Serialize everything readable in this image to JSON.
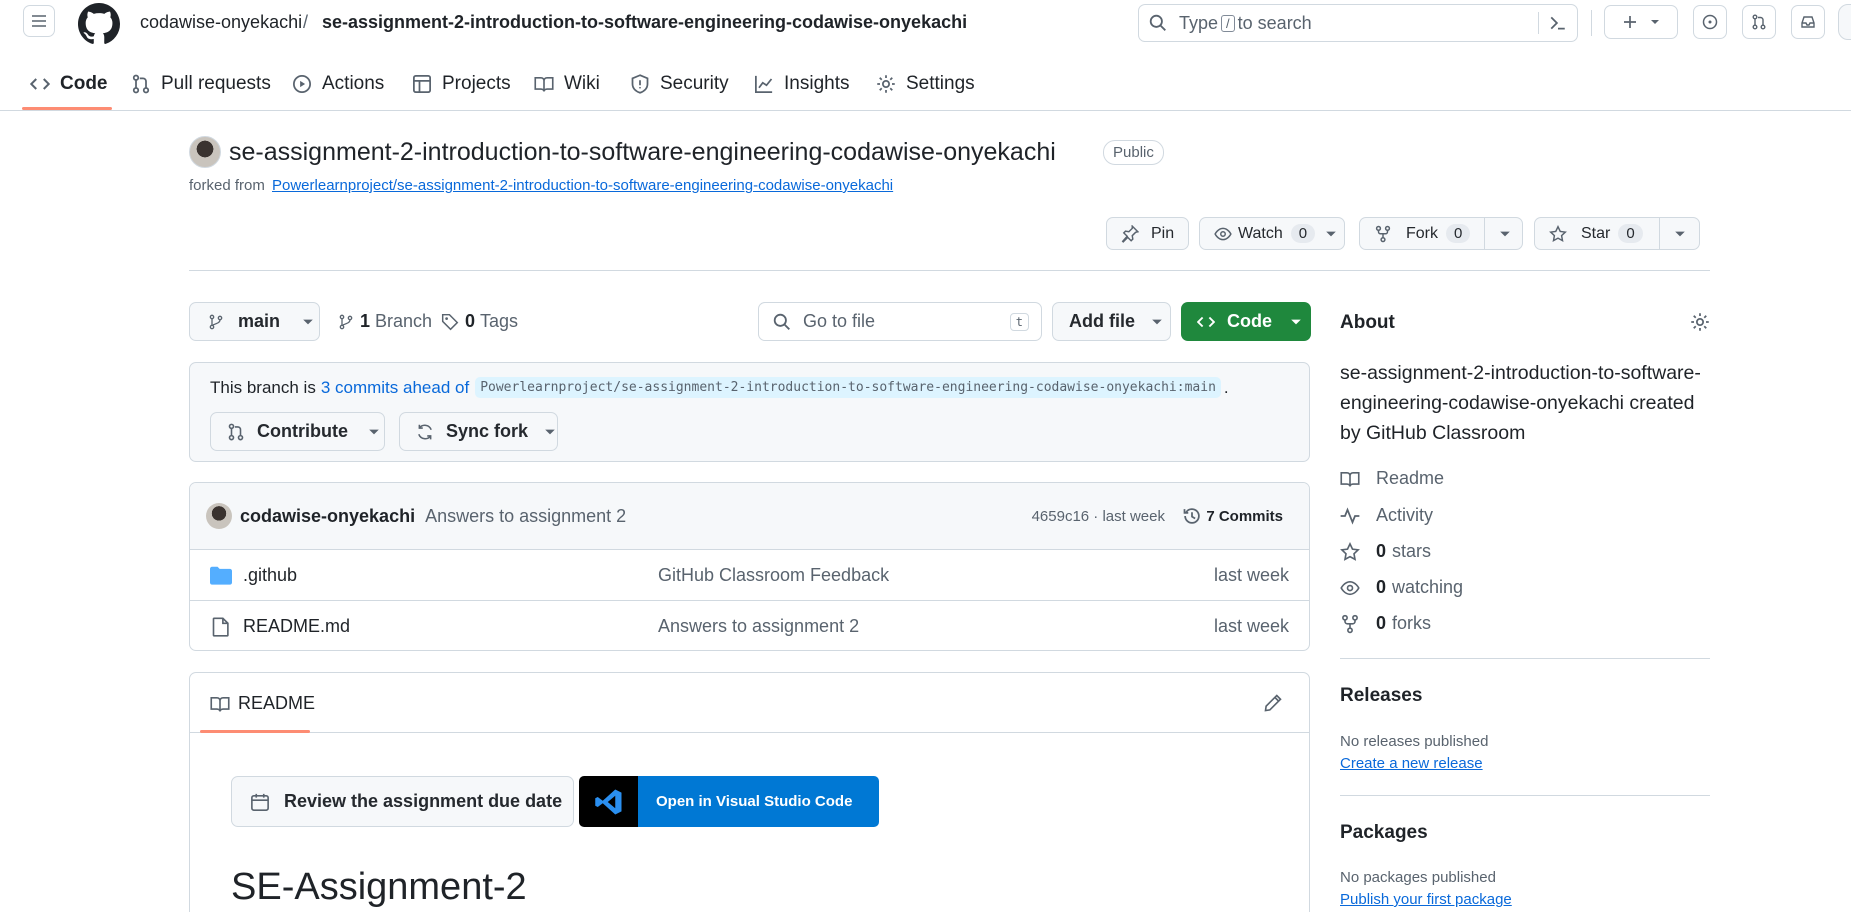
{
  "header": {
    "owner": "codawise-onyekachi",
    "separator": "/",
    "repo": "se-assignment-2-introduction-to-software-engineering-codawise-onyekachi",
    "search_pre": "Type",
    "search_key": "/",
    "search_post": "to search"
  },
  "nav": {
    "tabs": [
      {
        "label": "Code"
      },
      {
        "label": "Pull requests"
      },
      {
        "label": "Actions"
      },
      {
        "label": "Projects"
      },
      {
        "label": "Wiki"
      },
      {
        "label": "Security"
      },
      {
        "label": "Insights"
      },
      {
        "label": "Settings"
      }
    ]
  },
  "repo": {
    "name": "se-assignment-2-introduction-to-software-engineering-codawise-onyekachi",
    "visibility": "Public",
    "forked_prefix": "forked from",
    "forked_from": "Powerlearnproject/se-assignment-2-introduction-to-software-engineering-codawise-onyekachi",
    "pin": "Pin",
    "watch": "Watch",
    "watch_count": "0",
    "fork": "Fork",
    "fork_count": "0",
    "star": "Star",
    "star_count": "0"
  },
  "toolbar": {
    "branch": "main",
    "branches_count": "1",
    "branches_label": "Branch",
    "tags_count": "0",
    "tags_label": "Tags",
    "goto_placeholder": "Go to file",
    "goto_key": "t",
    "add_file": "Add file",
    "code": "Code"
  },
  "branch_info": {
    "prefix": "This branch is",
    "ahead": "3 commits ahead of",
    "ref": "Powerlearnproject/se-assignment-2-introduction-to-software-engineering-codawise-onyekachi:main",
    "suffix": ".",
    "contribute": "Contribute",
    "sync": "Sync fork"
  },
  "commit": {
    "author": "codawise-onyekachi",
    "message": "Answers to assignment 2",
    "sha_time": "4659c16 · last week",
    "commits": "7 Commits"
  },
  "files": [
    {
      "name": ".github",
      "message": "GitHub Classroom Feedback",
      "time": "last week",
      "type": "folder"
    },
    {
      "name": "README.md",
      "message": "Answers to assignment 2",
      "time": "last week",
      "type": "file"
    }
  ],
  "readme": {
    "tab": "README",
    "review_btn": "Review the assignment due date",
    "vscode_btn": "Open in Visual Studio Code",
    "heading": "SE-Assignment-2"
  },
  "about": {
    "title": "About",
    "description": "se-assignment-2-introduction-to-software-engineering-codawise-onyekachi created by GitHub Classroom",
    "readme": "Readme",
    "activity": "Activity",
    "stars_count": "0",
    "stars_label": "stars",
    "watching_count": "0",
    "watching_label": "watching",
    "forks_count": "0",
    "forks_label": "forks",
    "releases_title": "Releases",
    "releases_text": "No releases published",
    "releases_link": "Create a new release",
    "packages_title": "Packages",
    "packages_text": "No packages published",
    "packages_link": "Publish your first package"
  },
  "colors": {
    "accent": "#0969da",
    "code_button": "#1f883d",
    "tab_underline": "#fd8c73",
    "vscode_blue": "#0078d4"
  }
}
